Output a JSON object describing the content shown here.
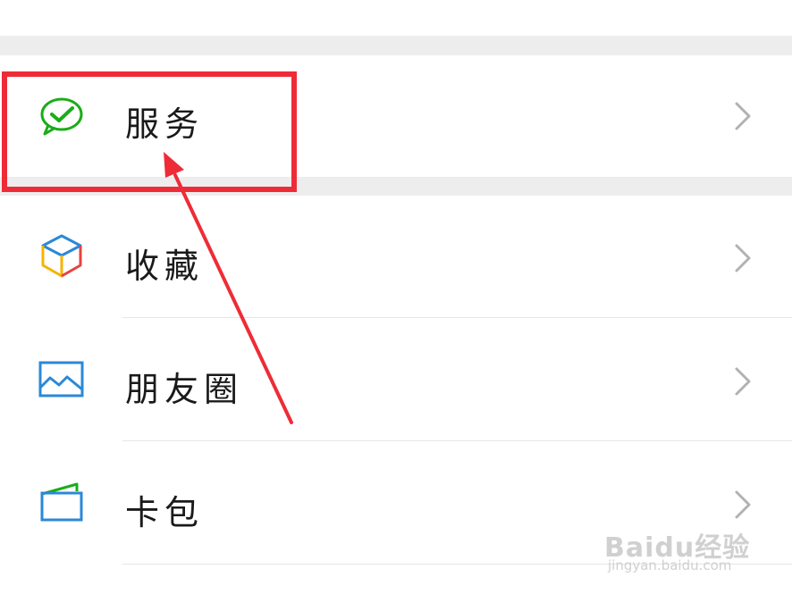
{
  "menu": {
    "items": [
      {
        "label": "服务",
        "icon": "wechat-pay-icon"
      },
      {
        "label": "收藏",
        "icon": "cube-icon"
      },
      {
        "label": "朋友圈",
        "icon": "picture-icon"
      },
      {
        "label": "卡包",
        "icon": "card-wallet-icon"
      }
    ]
  },
  "annotation": {
    "highlight_color": "#ee2c37",
    "target": "服务"
  },
  "watermark": {
    "logo": "Baidu经验",
    "url": "jingyan.baidu.com"
  },
  "colors": {
    "accent_green": "#1aad19",
    "chevron": "#b2b2b2",
    "divider": "#e6e6e6",
    "section_gap": "#ededed"
  }
}
